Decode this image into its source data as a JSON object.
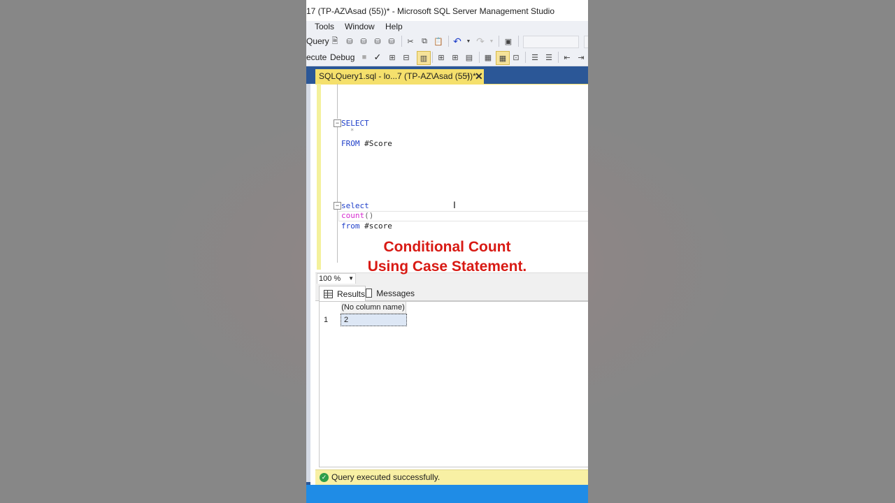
{
  "window": {
    "title": "17 (TP-AZ\\Asad (55))* - Microsoft SQL Server Management Studio"
  },
  "menu": {
    "items": [
      "Tools",
      "Window",
      "Help"
    ]
  },
  "toolbar": {
    "query_label": "Query",
    "execute_label": "ecute",
    "debug_label": "Debug"
  },
  "document_tab": {
    "title": "SQLQuery1.sql - lo...7 (TP-AZ\\Asad (55))*",
    "pin_glyph": "⊣",
    "close_glyph": "✕"
  },
  "code": {
    "line1_kw": "SELECT",
    "line2": "*",
    "line3_kw": "FROM",
    "line3_rest": " #Score",
    "line4_kw": "select",
    "line5_fn": "count",
    "line5_rest": "()",
    "line6_kw": "from",
    "line6_rest": " #score"
  },
  "overlay": {
    "line1": "Conditional Count",
    "line2": "Using Case Statement."
  },
  "zoom": {
    "value": "100 %"
  },
  "results": {
    "tabs": [
      "Results",
      "Messages"
    ],
    "column_header": "(No column name)",
    "row_number": "1",
    "cell_value": "2"
  },
  "status": {
    "message": "Query executed successfully."
  },
  "colors": {
    "accent_blue": "#2b5797",
    "tab_yellow": "#f5e06c",
    "overlay_red": "#d81a14",
    "status_yellow": "#f8f0a4"
  }
}
